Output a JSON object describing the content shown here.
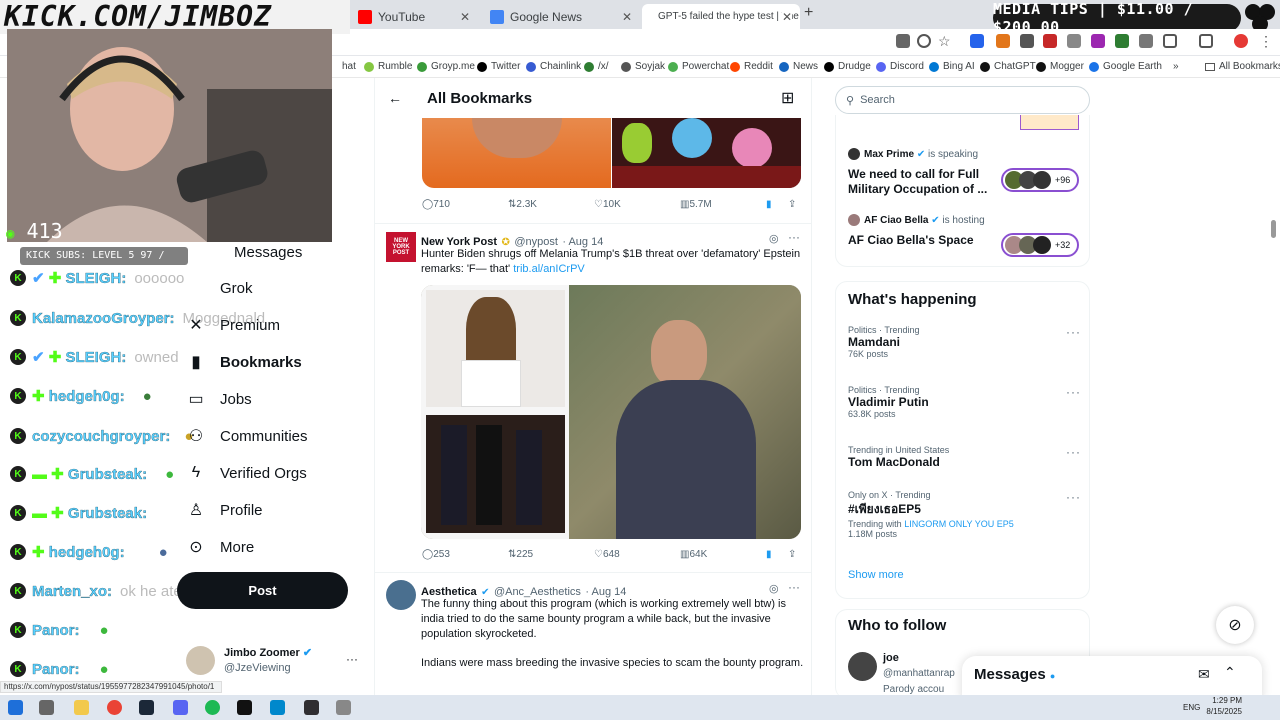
{
  "overlay": {
    "url_banner": "KICK.COM/JIMBOZ",
    "viewer_count": "413",
    "subs_bar": "KICK SUBS: LEVEL 5 97 / 100",
    "media_tips": "MEDIA TIPS | $11.00 / $200.00",
    "chat": [
      {
        "name": "SLEIGH:",
        "msg": "oooooo"
      },
      {
        "name": "KalamazooGroyper:",
        "msg": "Moggednald"
      },
      {
        "name": "SLEIGH:",
        "msg": "owned"
      },
      {
        "name": "hedgeh0g:",
        "msg": ""
      },
      {
        "name": "cozycouchgroyper:",
        "msg": ""
      },
      {
        "name": "Grubsteak:",
        "msg": ""
      },
      {
        "name": "Grubsteak:",
        "msg": ""
      },
      {
        "name": "hedgeh0g:",
        "msg": ""
      },
      {
        "name": "Marten_xo:",
        "msg": "ok he ate"
      },
      {
        "name": "Panor:",
        "msg": ""
      },
      {
        "name": "Panor:",
        "msg": ""
      }
    ]
  },
  "browser": {
    "tabs": [
      {
        "label": "YouTube",
        "color": "#ff0000"
      },
      {
        "label": "Google News",
        "color": "#4285f4"
      },
      {
        "label": "GPT-5 failed the hype test | The",
        "color": "#7b2fbf"
      }
    ],
    "bookmarks": [
      {
        "label": "hat",
        "color": "#888"
      },
      {
        "label": "Rumble",
        "color": "#85c742"
      },
      {
        "label": "Groyp.me",
        "color": "#3a9b3a"
      },
      {
        "label": "Twitter",
        "color": "#000"
      },
      {
        "label": "Chainlink",
        "color": "#375bd2"
      },
      {
        "label": "/x/",
        "color": "#2e7d32"
      },
      {
        "label": "Soyjak",
        "color": "#555"
      },
      {
        "label": "Powerchat",
        "color": "#4caf50"
      },
      {
        "label": "Reddit",
        "color": "#ff4500"
      },
      {
        "label": "News",
        "color": "#1565c0"
      },
      {
        "label": "Drudge",
        "color": "#000"
      },
      {
        "label": "Discord",
        "color": "#5865f2"
      },
      {
        "label": "Bing AI",
        "color": "#0078d4"
      },
      {
        "label": "ChatGPT",
        "color": "#111"
      },
      {
        "label": "Mogger",
        "color": "#111"
      },
      {
        "label": "Google Earth",
        "color": "#1a73e8"
      }
    ],
    "all_bookmarks": "All Bookmarks",
    "status_url": "https://x.com/nypost/status/1955977282347991045/photo/1"
  },
  "nav": {
    "items": [
      {
        "label": "Messages",
        "icon": "envelope-icon"
      },
      {
        "label": "Grok",
        "icon": "grok-icon"
      },
      {
        "label": "Premium",
        "icon": "x-icon"
      },
      {
        "label": "Bookmarks",
        "icon": "bookmark-icon"
      },
      {
        "label": "Jobs",
        "icon": "briefcase-icon"
      },
      {
        "label": "Communities",
        "icon": "people-icon"
      },
      {
        "label": "Verified Orgs",
        "icon": "lightning-icon"
      },
      {
        "label": "Profile",
        "icon": "person-icon"
      },
      {
        "label": "More",
        "icon": "more-circle-icon"
      }
    ],
    "post_label": "Post",
    "account": {
      "name": "Jimbo Zoomer",
      "handle": "@JzeViewing"
    }
  },
  "feed": {
    "title": "All Bookmarks",
    "tweet1_actions": {
      "replies": "710",
      "reposts": "2.3K",
      "likes": "10K",
      "views": "5.7M"
    },
    "tweet2": {
      "name": "New York Post",
      "handle": "@nypost",
      "date": "· Aug 14",
      "text": "Hunter Biden shrugs off Melania Trump's $1B threat over 'defamatory' Epstein remarks: 'F— that'",
      "link": "trib.al/anICrPV",
      "actions": {
        "replies": "253",
        "reposts": "225",
        "likes": "648",
        "views": "64K"
      }
    },
    "tweet3": {
      "name": "Aesthetica",
      "handle": "@Anc_Aesthetics",
      "date": "· Aug 14",
      "text1": "The funny thing about this program (which is working extremely well btw) is india tried to do the same bounty program a while back, but the invasive population skyrocketed.",
      "text2": "Indians were mass breeding the invasive species to scam the bounty program."
    }
  },
  "right": {
    "search_placeholder": "Search",
    "spaces": [
      {
        "host": "Max Prime",
        "status": "is speaking",
        "title": "We need to call for Full Military Occupation of ...",
        "count": "+96"
      },
      {
        "host": "AF Ciao Bella",
        "status": "is hosting",
        "title": "AF Ciao Bella's Space",
        "count": "+32"
      }
    ],
    "whats_happening": "What's happening",
    "trends": [
      {
        "context": "Politics · Trending",
        "name": "Mamdani",
        "posts": "76K posts"
      },
      {
        "context": "Politics · Trending",
        "name": "Vladimir Putin",
        "posts": "63.8K posts"
      },
      {
        "context": "Trending in United States",
        "name": "Tom MacDonald",
        "posts": ""
      },
      {
        "context": "Only on X · Trending",
        "name": "#เพียงเธอEP5",
        "posts": "1.18M posts",
        "with_label": "Trending with",
        "with_value": "LINGORM ONLY YOU EP5"
      }
    ],
    "show_more": "Show more",
    "who_to_follow": "Who to follow",
    "follow": {
      "name": "joe",
      "handle": "@manhattanrap",
      "sub": "Parody accou"
    },
    "messages_label": "Messages"
  },
  "taskbar": {
    "lang": "ENG",
    "time": "1:29 PM",
    "date": "8/15/2025"
  }
}
